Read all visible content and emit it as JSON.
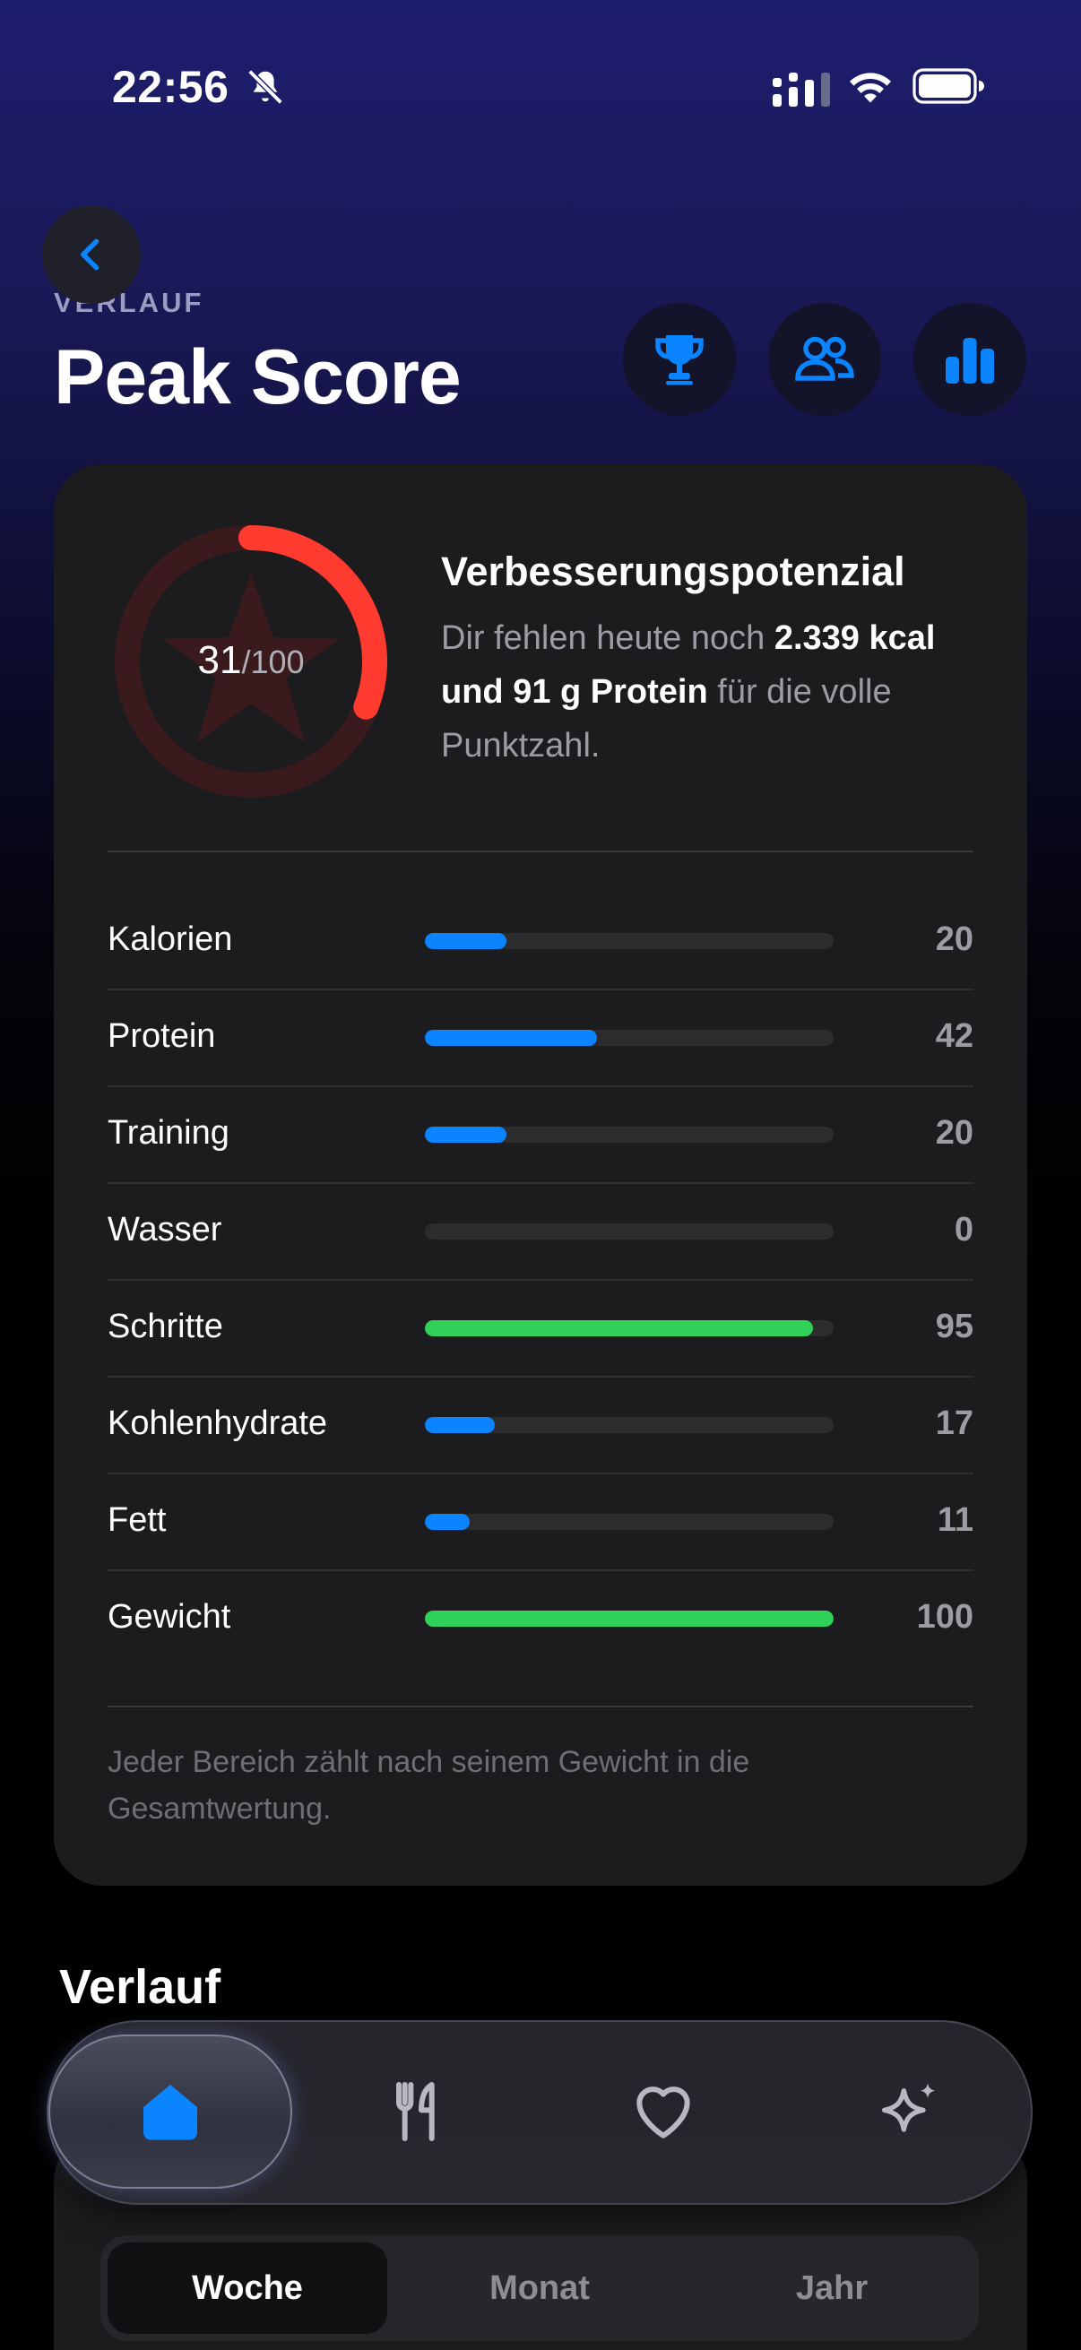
{
  "status": {
    "time": "22:56"
  },
  "header": {
    "overline": "VERLAUF",
    "title": "Peak Score"
  },
  "score": {
    "value": "31",
    "of": "/100",
    "fraction": 0.31
  },
  "improvement": {
    "title": "Verbesserungspotenzial",
    "text1": "Dir fehlen heute noch ",
    "strong": "2.339 kcal und 91 g Protein",
    "text2": " für die volle Punktzahl."
  },
  "metrics": [
    {
      "label": "Kalorien",
      "value": "20",
      "fraction": 0.2,
      "color": "#0a84ff"
    },
    {
      "label": "Protein",
      "value": "42",
      "fraction": 0.42,
      "color": "#0a84ff"
    },
    {
      "label": "Training",
      "value": "20",
      "fraction": 0.2,
      "color": "#0a84ff"
    },
    {
      "label": "Wasser",
      "value": "0",
      "fraction": 0.0,
      "color": "#0a84ff"
    },
    {
      "label": "Schritte",
      "value": "95",
      "fraction": 0.95,
      "color": "#30d158"
    },
    {
      "label": "Kohlenhydrate",
      "value": "17",
      "fraction": 0.17,
      "color": "#0a84ff"
    },
    {
      "label": "Fett",
      "value": "11",
      "fraction": 0.11,
      "color": "#0a84ff"
    },
    {
      "label": "Gewicht",
      "value": "100",
      "fraction": 1.0,
      "color": "#30d158"
    }
  ],
  "note": "Jeder Bereich zählt nach seinem Gewicht in die Gesamtwertung.",
  "section": {
    "title": "Verlauf"
  },
  "segment": {
    "options": [
      "Woche",
      "Monat",
      "Jahr"
    ],
    "selected": "Woche"
  },
  "colors": {
    "accent": "#0a84ff",
    "green": "#30d158",
    "ring": "#ff3b30"
  },
  "icons": [
    "chevron-left-icon",
    "trophy-icon",
    "people-icon",
    "bar-chart-icon",
    "home-icon",
    "fork-knife-icon",
    "heart-icon",
    "sparkles-icon"
  ]
}
